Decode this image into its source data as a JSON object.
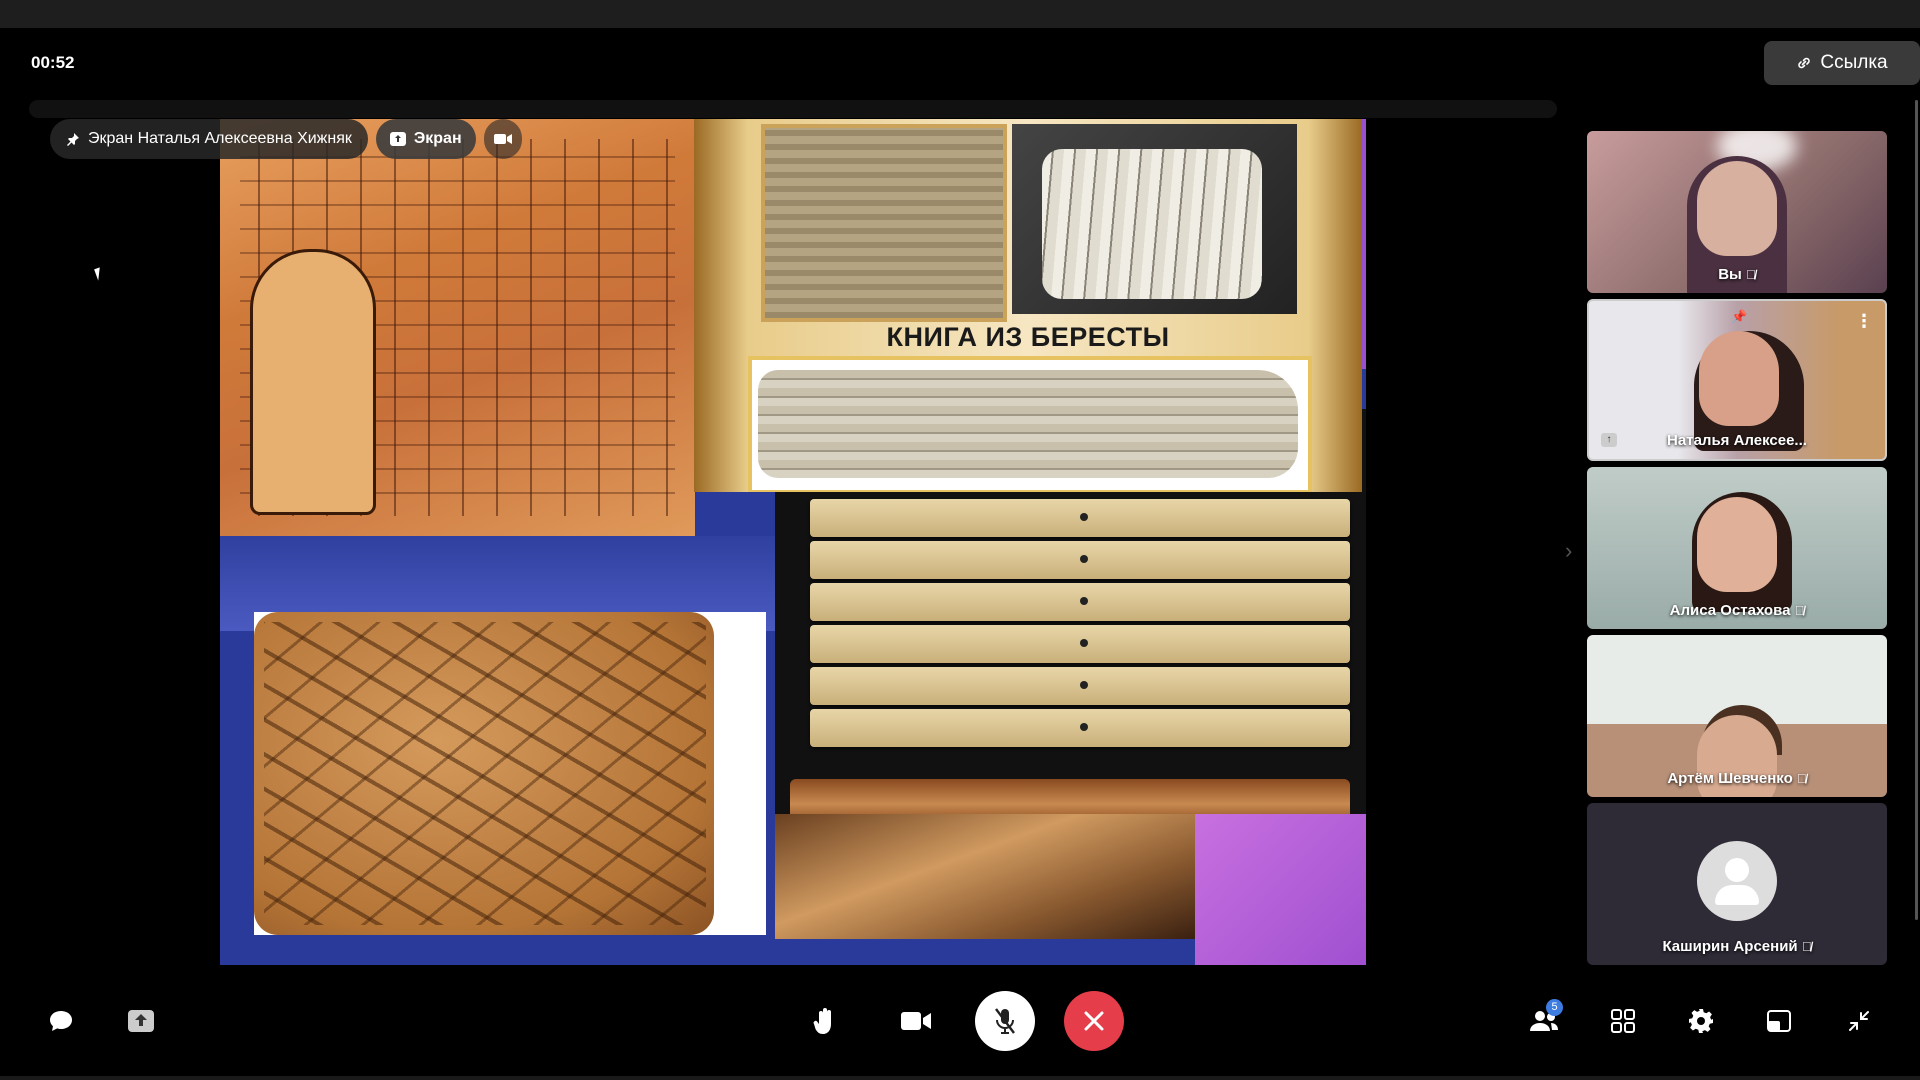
{
  "header": {
    "timer": "00:52",
    "link_label": "Ссылка"
  },
  "presentation": {
    "pin_badge_label": "Экран Наталья Алексеевна Хижняк",
    "screen_badge_label": "Экран",
    "slide_title": "КНИГА ИЗ БЕРЕСТЫ"
  },
  "participants": [
    {
      "name": "Вы",
      "muted": true
    },
    {
      "name": "Наталья Алексее...",
      "muted": false,
      "pinned": true,
      "sharing": true
    },
    {
      "name": "Алиса Остахова",
      "muted": true
    },
    {
      "name": "Артём Шевченко",
      "muted": true
    },
    {
      "name": "Каширин Арсений",
      "muted": true
    }
  ],
  "controls": {
    "people_count": "5",
    "accent_colors": {
      "hangup": "#e53e4a",
      "badge": "#3d7ce0"
    }
  },
  "icons": [
    "chat-icon",
    "share-screen-icon",
    "raise-hand-icon",
    "camera-icon",
    "mic-off-icon",
    "hangup-icon",
    "people-icon",
    "grid-icon",
    "settings-icon",
    "layout-icon",
    "collapse-icon",
    "link-icon",
    "pin-icon"
  ]
}
